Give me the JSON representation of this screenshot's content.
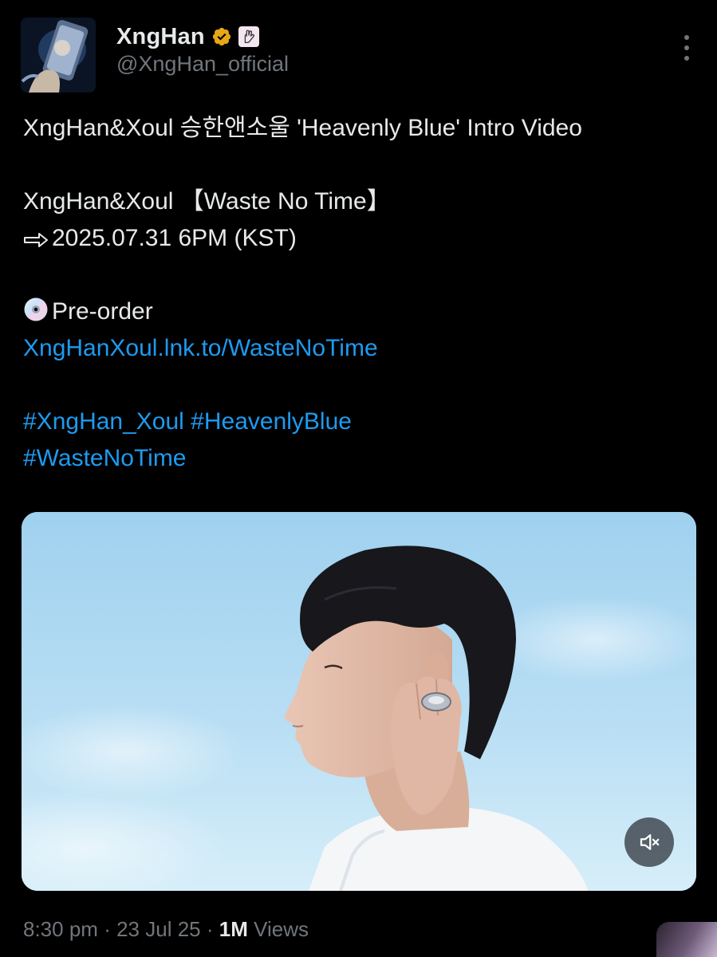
{
  "author": {
    "display_name": "XngHan",
    "handle": "@XngHan_official",
    "verified": true,
    "verified_color": "#e6a817",
    "affiliation_icon": "hand-sign-icon"
  },
  "tweet": {
    "line1": "XngHan&Xoul 승한앤소울 'Heavenly Blue' Intro Video",
    "line2": "XngHan&Xoul 【Waste No Time】",
    "line3_icon": "arrow-right-icon",
    "line3": "2025.07.31 6PM (KST)",
    "preorder_icon": "cd-icon",
    "preorder_label": "Pre-order",
    "preorder_link": "XngHanXoul.lnk.to/WasteNoTime",
    "hashtags": [
      "#XngHan_Xoul",
      "#HeavenlyBlue",
      "#WasteNoTime"
    ]
  },
  "media": {
    "type": "video",
    "mute_icon": "volume-muted-icon"
  },
  "meta": {
    "time": "8:30 pm",
    "date": "23 Jul 25",
    "views_count": "1M",
    "views_label": "Views",
    "separator": "·"
  },
  "colors": {
    "background": "#000000",
    "text": "#e7e9ea",
    "muted": "#71767b",
    "link": "#1d9bf0"
  }
}
